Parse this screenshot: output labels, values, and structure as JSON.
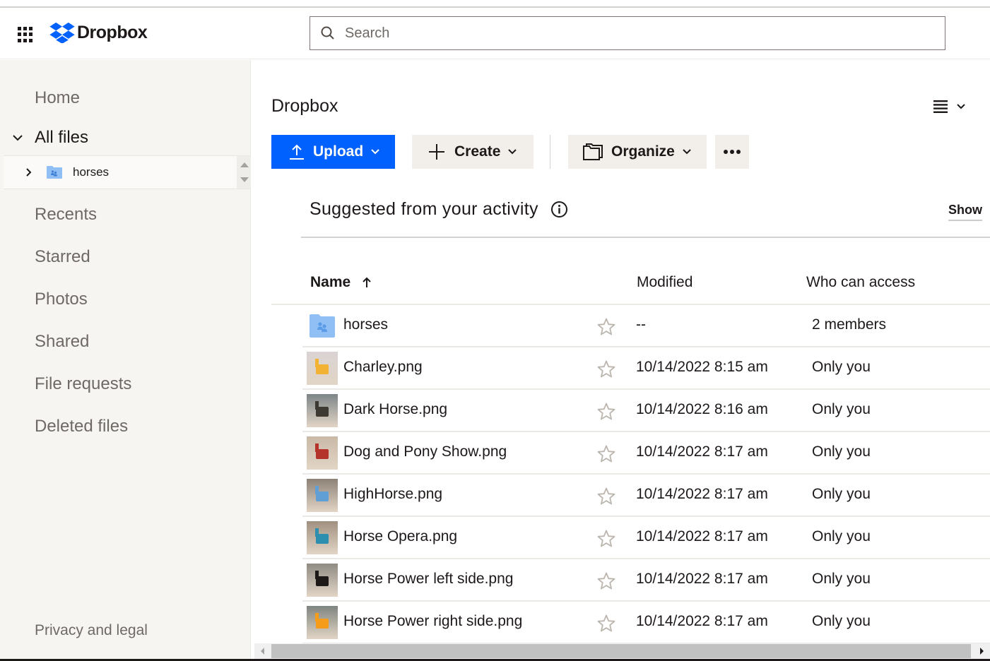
{
  "header": {
    "brand": "Dropbox",
    "brand_color": "#0061fe",
    "search_placeholder": "Search",
    "search_value": ""
  },
  "sidebar": {
    "home": "Home",
    "all_files": "All files",
    "tree_folder": "horses",
    "items": [
      {
        "label": "Recents"
      },
      {
        "label": "Starred"
      },
      {
        "label": "Photos"
      },
      {
        "label": "Shared"
      },
      {
        "label": "File requests"
      },
      {
        "label": "Deleted files"
      }
    ],
    "privacy": "Privacy and legal"
  },
  "main": {
    "breadcrumb": "Dropbox",
    "toolbar": {
      "upload": "Upload",
      "create": "Create",
      "organize": "Organize",
      "more": "More"
    },
    "suggested": {
      "title": "Suggested from your activity",
      "show": "Show"
    },
    "table": {
      "columns": {
        "name": "Name",
        "modified": "Modified",
        "access": "Who can access"
      },
      "sort": "ascending",
      "rows": [
        {
          "name": "horses",
          "type": "shared-folder",
          "modified": "--",
          "access": "2 members",
          "thumb": [
            "#8fbff5",
            "#5b9be8"
          ]
        },
        {
          "name": "Charley.png",
          "type": "image",
          "modified": "10/14/2022 8:15 am",
          "access": "Only you",
          "thumb": [
            "#d9d3d3",
            "#f2b233"
          ]
        },
        {
          "name": "Dark Horse.png",
          "type": "image",
          "modified": "10/14/2022 8:16 am",
          "access": "Only you",
          "thumb": [
            "#7d8588",
            "#3d3a33"
          ]
        },
        {
          "name": "Dog and Pony Show.png",
          "type": "image",
          "modified": "10/14/2022 8:17 am",
          "access": "Only you",
          "thumb": [
            "#c9b8a6",
            "#b4342c"
          ]
        },
        {
          "name": "HighHorse.png",
          "type": "image",
          "modified": "10/14/2022 8:17 am",
          "access": "Only you",
          "thumb": [
            "#8d8277",
            "#5f9fd6"
          ]
        },
        {
          "name": "Horse Opera.png",
          "type": "image",
          "modified": "10/14/2022 8:17 am",
          "access": "Only you",
          "thumb": [
            "#a09080",
            "#2c8fb0"
          ]
        },
        {
          "name": "Horse Power left side.png",
          "type": "image",
          "modified": "10/14/2022 8:17 am",
          "access": "Only you",
          "thumb": [
            "#8f8b84",
            "#1e1919"
          ]
        },
        {
          "name": "Horse Power right side.png",
          "type": "image",
          "modified": "10/14/2022 8:17 am",
          "access": "Only you",
          "thumb": [
            "#7f8580",
            "#f59d1a"
          ]
        }
      ]
    }
  }
}
